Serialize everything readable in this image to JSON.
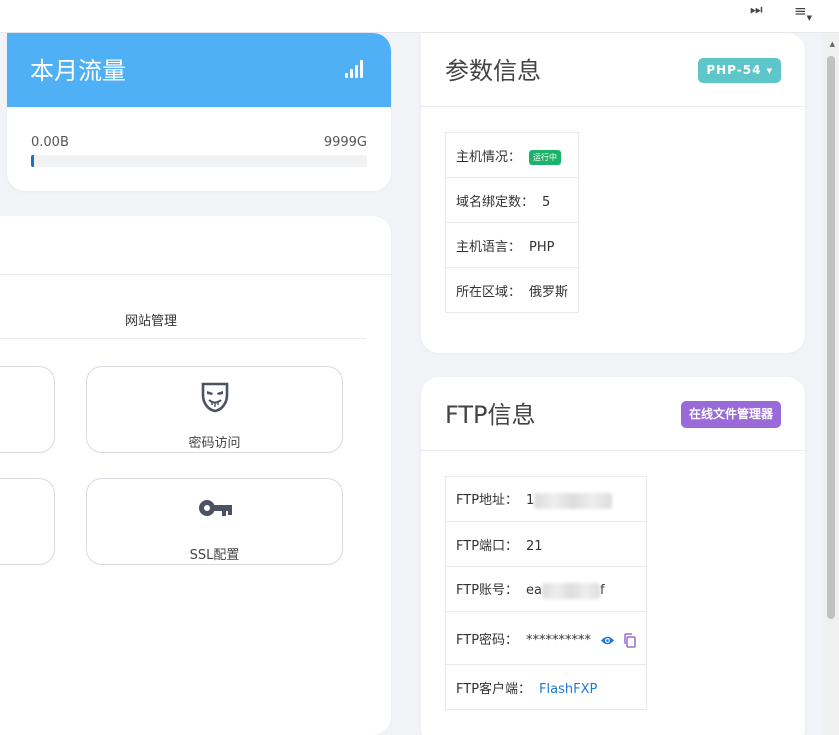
{
  "topbar": {
    "skip_icon": "skip-forward-icon",
    "menu_icon": "menu-icon"
  },
  "traffic": {
    "title": "本月流量",
    "icon": "signal-bars-icon",
    "min_label": "0.00B",
    "max_label": "9999G",
    "progress_fraction": 0.005,
    "header_color": "#4fb0f5"
  },
  "site_management": {
    "title": "网站管理",
    "tiles": [
      {
        "label": "密码访问",
        "icon": "masked-face-icon"
      },
      {
        "label": "SSL配置",
        "icon": "key-icon"
      }
    ]
  },
  "params": {
    "title": "参数信息",
    "php_button": "PHP-54",
    "rows": {
      "status_label": "主机情况：",
      "status_badge": "运行中",
      "domains_label": "域名绑定数：",
      "domains_value": "5",
      "language_label": "主机语言：",
      "language_value": "PHP",
      "region_label": "所在区域：",
      "region_value": "俄罗斯"
    }
  },
  "ftp": {
    "title": "FTP信息",
    "file_manager_button": "在线文件管理器",
    "rows": {
      "address_label": "FTP地址：",
      "address_value_prefix": "1",
      "port_label": "FTP端口：",
      "port_value": "21",
      "account_label": "FTP账号：",
      "account_prefix": "ea",
      "account_suffix": "f",
      "password_label": "FTP密码：",
      "password_value": "**********",
      "client_label": "FTP客户端：",
      "client_value": "FlashFXP"
    }
  }
}
